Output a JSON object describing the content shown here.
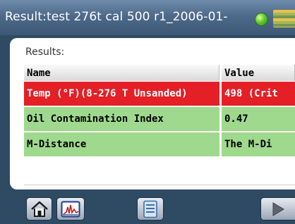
{
  "window": {
    "title": "Result:test 276t cal 500 r1_2006-01-",
    "status_color": "#5fc92d"
  },
  "results": {
    "label": "Results:",
    "columns": [
      "Name",
      "Value"
    ],
    "rows": [
      {
        "name": "Temp (°F)(8-276 T Unsanded)",
        "value": "498 (Crit",
        "status_color": "#e41f26"
      },
      {
        "name": "Oil Contamination Index",
        "value": "0.47",
        "status_color": "#9fd98e"
      },
      {
        "name": "M-Distance",
        "value": "The M-Di",
        "status_color": "#9fd98e"
      }
    ]
  },
  "toolbar": {
    "buttons": [
      {
        "name": "home",
        "icon": "home-icon"
      },
      {
        "name": "chart",
        "icon": "chart-icon"
      },
      {
        "name": "report",
        "icon": "document-icon"
      },
      {
        "name": "next",
        "icon": "play-arrow-icon"
      }
    ]
  }
}
